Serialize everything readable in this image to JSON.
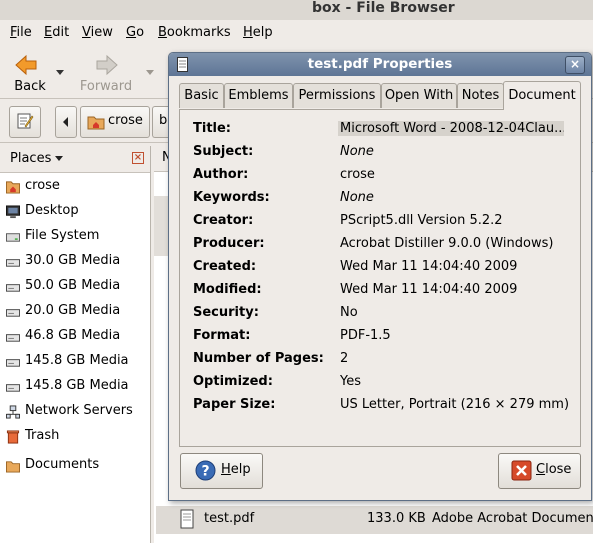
{
  "window": {
    "title": "box - File Browser"
  },
  "menubar": [
    {
      "label": "File",
      "u": "F",
      "rest": "ile"
    },
    {
      "label": "Edit",
      "u": "E",
      "rest": "dit"
    },
    {
      "label": "View",
      "u": "V",
      "rest": "iew"
    },
    {
      "label": "Go",
      "u": "G",
      "rest": "o"
    },
    {
      "label": "Bookmarks",
      "u": "B",
      "rest": "ookmarks"
    },
    {
      "label": "Help",
      "u": "H",
      "rest": "elp"
    }
  ],
  "toolbar": {
    "back": "Back",
    "forward": "Forward"
  },
  "location": {
    "crumb": "crose",
    "next_partial": "b"
  },
  "sidebar": {
    "header": "Places",
    "items": [
      {
        "label": "crose",
        "icon": "home-folder-icon"
      },
      {
        "label": "Desktop",
        "icon": "desktop-icon"
      },
      {
        "label": "File System",
        "icon": "harddisk-icon"
      },
      {
        "label": "30.0 GB Media",
        "icon": "drive-icon"
      },
      {
        "label": "50.0 GB Media",
        "icon": "drive-icon"
      },
      {
        "label": "20.0 GB Media",
        "icon": "drive-icon"
      },
      {
        "label": "46.8 GB Media",
        "icon": "drive-icon"
      },
      {
        "label": "145.8 GB Media",
        "icon": "drive-icon"
      },
      {
        "label": "145.8 GB Media",
        "icon": "drive-icon"
      },
      {
        "label": "Network Servers",
        "icon": "network-icon"
      },
      {
        "label": "Trash",
        "icon": "trash-icon"
      },
      {
        "label": "Documents",
        "icon": "folder-icon"
      }
    ]
  },
  "file_list": {
    "column_partial": "N",
    "row": {
      "name": "test.pdf",
      "size": "133.0 KB",
      "type": "Adobe Acrobat Documen"
    }
  },
  "dialog": {
    "title": "test.pdf Properties",
    "tabs": [
      "Basic",
      "Emblems",
      "Permissions",
      "Open With",
      "Notes",
      "Document"
    ],
    "active_tab": "Document",
    "properties": [
      {
        "label": "Title:",
        "value": "Microsoft Word - 2008-12-04Clau..."
      },
      {
        "label": "Subject:",
        "value": "None"
      },
      {
        "label": "Author:",
        "value": "crose"
      },
      {
        "label": "Keywords:",
        "value": "None"
      },
      {
        "label": "Creator:",
        "value": "PScript5.dll Version 5.2.2"
      },
      {
        "label": "Producer:",
        "value": "Acrobat Distiller 9.0.0 (Windows)"
      },
      {
        "label": "Created:",
        "value": "Wed Mar 11 14:04:40 2009"
      },
      {
        "label": "Modified:",
        "value": "Wed Mar 11 14:04:40 2009"
      },
      {
        "label": "Security:",
        "value": "No"
      },
      {
        "label": "Format:",
        "value": "PDF-1.5"
      },
      {
        "label": "Number of Pages:",
        "value": "2"
      },
      {
        "label": "Optimized:",
        "value": "Yes"
      },
      {
        "label": "Paper Size:",
        "value": "US Letter, Portrait (216 × 279 mm)"
      }
    ],
    "help_button": {
      "u": "H",
      "rest": "elp",
      "label": "Help"
    },
    "close_button": {
      "u": "C",
      "rest": "lose",
      "label": "Close"
    }
  },
  "colors": {
    "titlebar": "#6a80a0",
    "window_bg": "#efebe7",
    "close_red": "#d64a2a",
    "help_blue": "#3a6bb5"
  }
}
